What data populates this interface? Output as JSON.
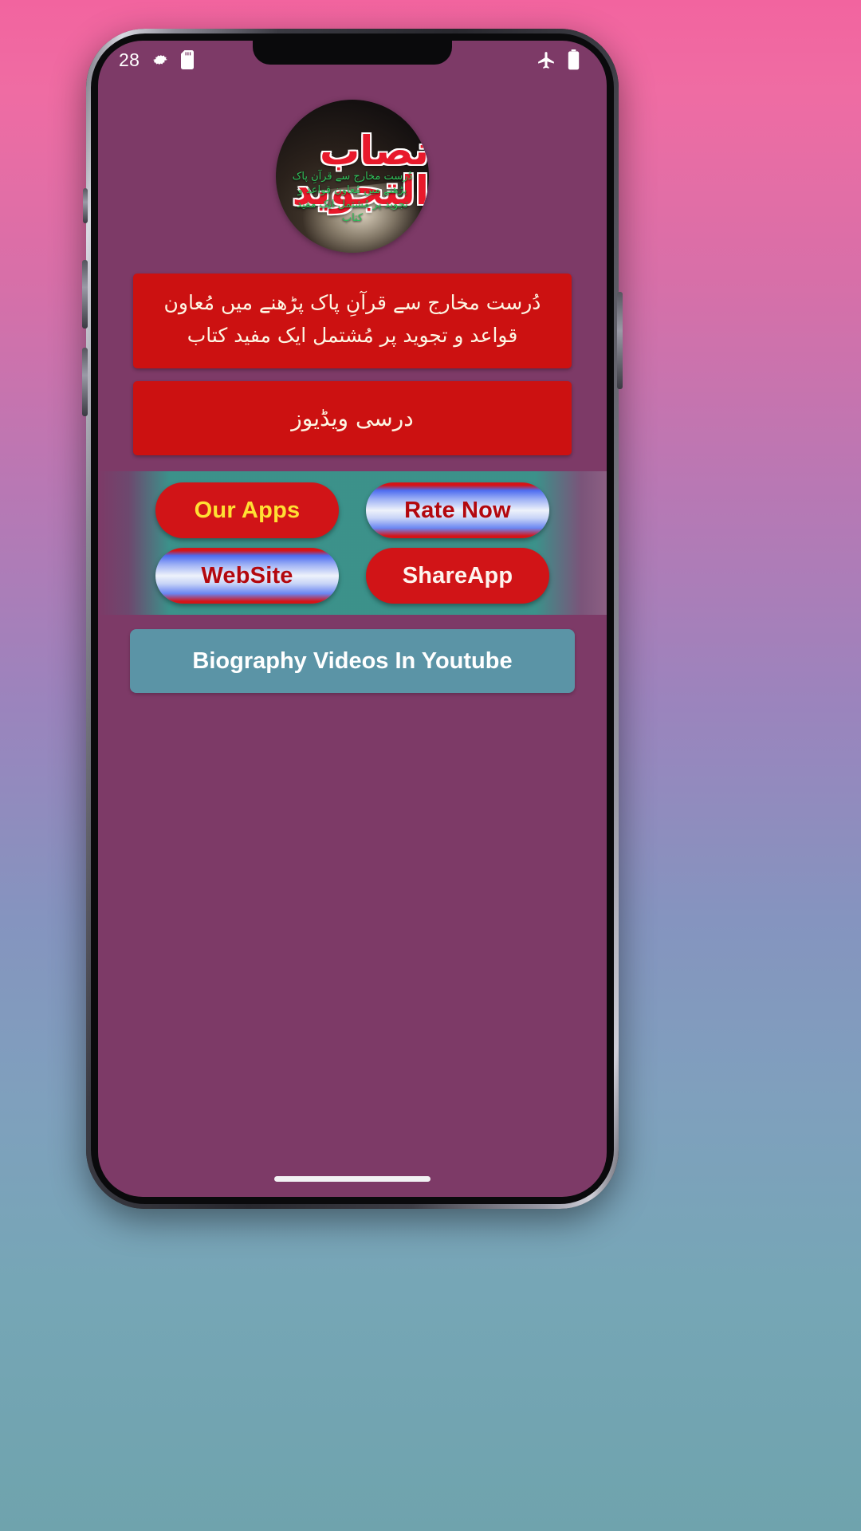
{
  "wallpaper": {
    "gradient_top": "#f2649f",
    "gradient_bottom": "#6fa3ad"
  },
  "device": {
    "frame_color": "#27272d",
    "screen_background": "#7d3a67"
  },
  "status_bar": {
    "clock": "28",
    "left_icons": [
      "gear-icon",
      "sd-card-icon"
    ],
    "right_icons": [
      "airplane-mode-icon",
      "battery-icon"
    ],
    "text_color": "#ffffff"
  },
  "app": {
    "logo": {
      "title_urdu": "نصاب التجوید",
      "subtitle_urdu": "دُرست مخارج سے قرآنِ پاک پڑھنے میں مُعاون قواعد و تجوید پر مُشتمل ایک مفید کتاب",
      "title_color": "#e8192b",
      "subtitle_color": "#2fbf5a"
    },
    "description_banner": {
      "text": "دُرست مخارج سے قرآنِ پاک پڑھنے میں مُعاون قواعد و تجوید پر مُشتمل ایک مفید کتاب",
      "background": "#cc1111",
      "text_color": "#fdf6e3"
    },
    "videos_banner": {
      "text": "درسی ویڈیوز",
      "background": "#cc1111",
      "text_color": "#fdf6e3"
    },
    "pill_panel": {
      "panel_color": "#38968c",
      "buttons": [
        {
          "label": "Our Apps",
          "style": "red",
          "text_color": "#ffe033"
        },
        {
          "label": "Rate Now",
          "style": "gradient",
          "text_color": "#b3080e"
        },
        {
          "label": "WebSite",
          "style": "gradient",
          "text_color": "#b3080e"
        },
        {
          "label": "ShareApp",
          "style": "red",
          "text_color": "#fdf4ee"
        }
      ]
    },
    "youtube_bar": {
      "label": "Biography Videos In Youtube",
      "background": "#5b94a6",
      "text_color": "#ffffff"
    }
  }
}
